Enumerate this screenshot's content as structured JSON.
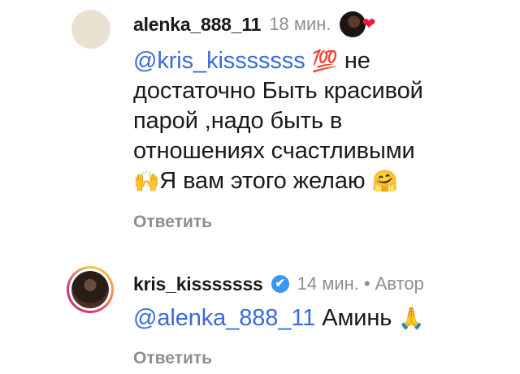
{
  "comments": [
    {
      "username": "alenka_888_11",
      "time": "18 мин.",
      "mention": "@kris_kisssssss",
      "emoji_100": "💯",
      "text1": " не",
      "line2": "достаточно Быть красивой",
      "line3": "парой ,надо быть в",
      "line4": "отношениях счастливыми",
      "emoji_hands": "🙌",
      "line5": "Я вам этого желаю ",
      "emoji_hug": "🤗",
      "reply_label": "Ответить",
      "liked_by_author_icon": "heart-icon"
    },
    {
      "username": "kris_kisssssss",
      "verified_mark": "✔",
      "time": "14 мин.",
      "separator": "•",
      "author_label": "Автор",
      "mention": "@alenka_888_11",
      "text": " Аминь ",
      "emoji_pray": "🙏",
      "reply_label": "Ответить"
    }
  ],
  "colors": {
    "mention": "#3b6bd4",
    "muted": "#8e8e8e",
    "verified": "#3897f0",
    "heart": "#ed1a3a"
  }
}
